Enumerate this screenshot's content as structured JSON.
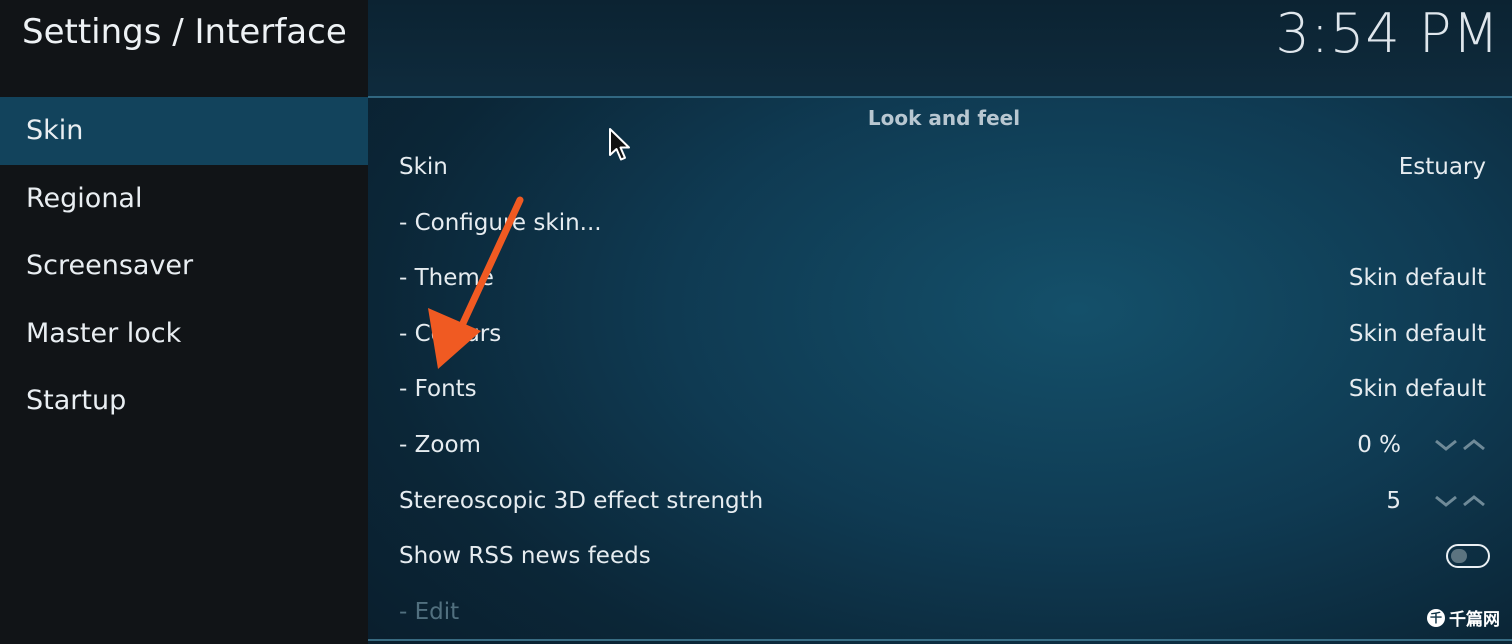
{
  "header": {
    "title": "Settings / Interface",
    "clock": "3:54 PM"
  },
  "sidebar": {
    "items": [
      {
        "label": "Skin",
        "active": true
      },
      {
        "label": "Regional"
      },
      {
        "label": "Screensaver"
      },
      {
        "label": "Master lock"
      },
      {
        "label": "Startup"
      }
    ]
  },
  "main": {
    "section_title": "Look and feel",
    "settings": [
      {
        "label": "Skin",
        "value": "Estuary"
      },
      {
        "label": "- Configure skin..."
      },
      {
        "label": "- Theme",
        "value": "Skin default"
      },
      {
        "label": "- Colours",
        "value": "Skin default"
      },
      {
        "label": "- Fonts",
        "value": "Skin default"
      },
      {
        "label": "- Zoom",
        "value": "0 %"
      },
      {
        "label": "Stereoscopic 3D effect strength",
        "value": "5"
      },
      {
        "label": "Show RSS news feeds",
        "toggle_on": false
      },
      {
        "label": "- Edit",
        "disabled": true
      }
    ]
  },
  "icons": {
    "spinner": "chevron-down-up-icon",
    "cursor": "mouse-pointer-icon",
    "annotation": "orange-arrow-icon"
  },
  "colors": {
    "sidebar_bg": "#111417",
    "active_item": "#12435c",
    "panel_bg": "#0f3a52",
    "annotation_arrow": "#f05a22",
    "disabled_text": "#51707f"
  },
  "watermark": {
    "logo_char": "千",
    "text": "千篇网"
  }
}
